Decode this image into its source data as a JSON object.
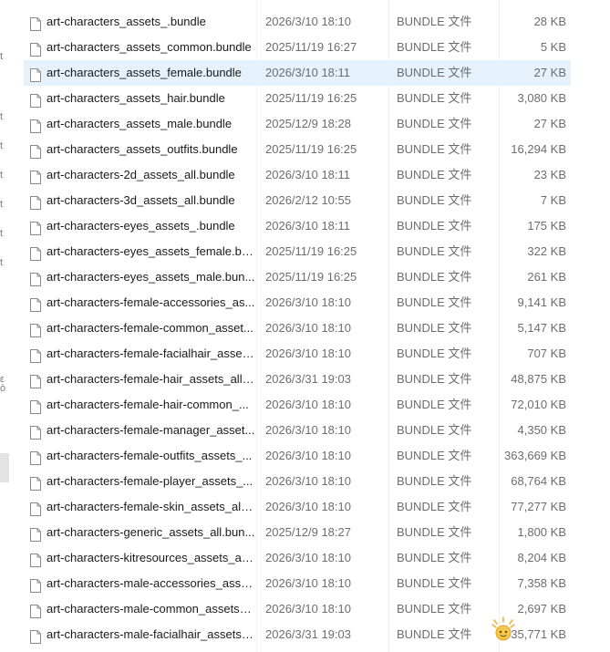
{
  "file_type": "BUNDLE 文件",
  "nav_marks": [
    "t",
    "t",
    "t",
    "t",
    "t",
    "t",
    "t",
    "ε",
    "ò"
  ],
  "files": [
    {
      "name": "art-characters_assets_.bundle",
      "modified": "2026/3/10 18:10",
      "size": "28 KB",
      "selected": false
    },
    {
      "name": "art-characters_assets_common.bundle",
      "modified": "2025/11/19 16:27",
      "size": "5 KB",
      "selected": false
    },
    {
      "name": "art-characters_assets_female.bundle",
      "modified": "2026/3/10 18:11",
      "size": "27 KB",
      "selected": true
    },
    {
      "name": "art-characters_assets_hair.bundle",
      "modified": "2025/11/19 16:25",
      "size": "3,080 KB",
      "selected": false
    },
    {
      "name": "art-characters_assets_male.bundle",
      "modified": "2025/12/9 18:28",
      "size": "27 KB",
      "selected": false
    },
    {
      "name": "art-characters_assets_outfits.bundle",
      "modified": "2025/11/19 16:25",
      "size": "16,294 KB",
      "selected": false
    },
    {
      "name": "art-characters-2d_assets_all.bundle",
      "modified": "2026/3/10 18:11",
      "size": "23 KB",
      "selected": false
    },
    {
      "name": "art-characters-3d_assets_all.bundle",
      "modified": "2026/2/12 10:55",
      "size": "7 KB",
      "selected": false
    },
    {
      "name": "art-characters-eyes_assets_.bundle",
      "modified": "2026/3/10 18:11",
      "size": "175 KB",
      "selected": false
    },
    {
      "name": "art-characters-eyes_assets_female.bu...",
      "modified": "2025/11/19 16:25",
      "size": "322 KB",
      "selected": false
    },
    {
      "name": "art-characters-eyes_assets_male.bun...",
      "modified": "2025/11/19 16:25",
      "size": "261 KB",
      "selected": false
    },
    {
      "name": "art-characters-female-accessories_as...",
      "modified": "2026/3/10 18:10",
      "size": "9,141 KB",
      "selected": false
    },
    {
      "name": "art-characters-female-common_asset...",
      "modified": "2026/3/10 18:10",
      "size": "5,147 KB",
      "selected": false
    },
    {
      "name": "art-characters-female-facialhair_asset...",
      "modified": "2026/3/10 18:10",
      "size": "707 KB",
      "selected": false
    },
    {
      "name": "art-characters-female-hair_assets_all....",
      "modified": "2026/3/31 19:03",
      "size": "48,875 KB",
      "selected": false
    },
    {
      "name": "art-characters-female-hair-common_...",
      "modified": "2026/3/10 18:10",
      "size": "72,010 KB",
      "selected": false
    },
    {
      "name": "art-characters-female-manager_asset...",
      "modified": "2026/3/10 18:10",
      "size": "4,350 KB",
      "selected": false
    },
    {
      "name": "art-characters-female-outfits_assets_...",
      "modified": "2026/3/10 18:10",
      "size": "363,669 KB",
      "selected": false
    },
    {
      "name": "art-characters-female-player_assets_...",
      "modified": "2026/3/10 18:10",
      "size": "68,764 KB",
      "selected": false
    },
    {
      "name": "art-characters-female-skin_assets_all....",
      "modified": "2026/3/10 18:10",
      "size": "77,277 KB",
      "selected": false
    },
    {
      "name": "art-characters-generic_assets_all.bun...",
      "modified": "2025/12/9 18:27",
      "size": "1,800 KB",
      "selected": false
    },
    {
      "name": "art-characters-kitresources_assets_all...",
      "modified": "2026/3/10 18:10",
      "size": "8,204 KB",
      "selected": false
    },
    {
      "name": "art-characters-male-accessories_asse...",
      "modified": "2026/3/10 18:10",
      "size": "7,358 KB",
      "selected": false
    },
    {
      "name": "art-characters-male-common_assets_...",
      "modified": "2026/3/10 18:10",
      "size": "2,697 KB",
      "selected": false
    },
    {
      "name": "art-characters-male-facialhair_assets_...",
      "modified": "2026/3/31 19:03",
      "size": "35,771 KB",
      "selected": false
    }
  ]
}
